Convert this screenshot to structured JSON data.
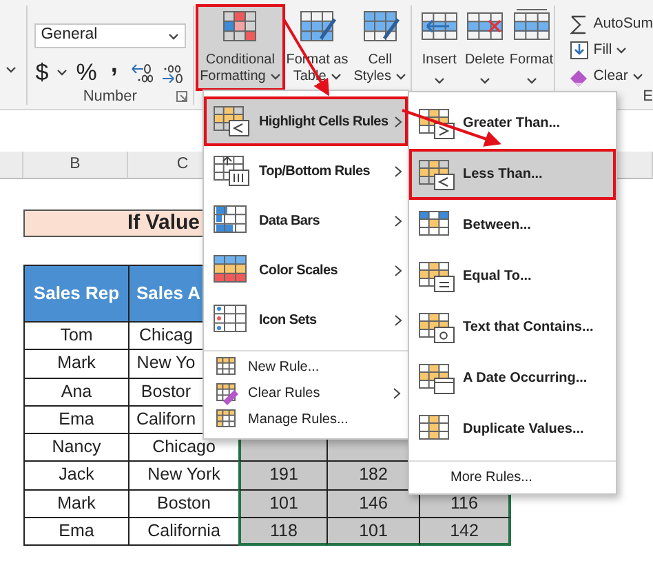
{
  "ribbon": {
    "number_group": {
      "format": "General",
      "currency": "$",
      "percent": "%",
      "comma": ",",
      "label": "Number"
    },
    "styles_group": {
      "buttons": [
        {
          "lines": [
            "Conditional",
            "Formatting"
          ],
          "selected": true
        },
        {
          "lines": [
            "Format as",
            "Table"
          ],
          "selected": false
        },
        {
          "lines": [
            "Cell",
            "Styles"
          ],
          "selected": false
        }
      ]
    },
    "cells_group": {
      "buttons": [
        "Insert",
        "Delete",
        "Format"
      ]
    },
    "editing_group": {
      "items": [
        "AutoSum",
        "Fill",
        "Clear"
      ],
      "label": "E"
    }
  },
  "sheet": {
    "column_headers": [
      "B",
      "C"
    ],
    "title": "If Value",
    "table_headers": [
      "Sales Rep",
      "Sales A"
    ],
    "rows": [
      {
        "rep": "Tom",
        "area": "Chicag",
        "values": [],
        "in_selection": false
      },
      {
        "rep": "Mark",
        "area": "New Yo",
        "values": [],
        "in_selection": false
      },
      {
        "rep": "Ana",
        "area": "Bostor",
        "values": [],
        "in_selection": false
      },
      {
        "rep": "Ema",
        "area": "Californ",
        "values": [],
        "in_selection": false
      },
      {
        "rep": "Nancy",
        "area": "Chicago",
        "values": [],
        "in_selection": true
      },
      {
        "rep": "Jack",
        "area": "New York",
        "values": [
          "191",
          "182"
        ],
        "in_selection": true
      },
      {
        "rep": "Mark",
        "area": "Boston",
        "values": [
          "101",
          "146",
          "116"
        ],
        "in_selection": true
      },
      {
        "rep": "Ema",
        "area": "California",
        "values": [
          "118",
          "101",
          "142"
        ],
        "in_selection": true
      }
    ]
  },
  "menu": {
    "items": [
      {
        "label": "Highlight Cells Rules",
        "kind": "large",
        "submenu": true,
        "selected": true
      },
      {
        "label": "Top/Bottom Rules",
        "kind": "large",
        "submenu": true,
        "selected": false
      },
      {
        "label": "Data Bars",
        "kind": "large",
        "submenu": true,
        "selected": false
      },
      {
        "label": "Color Scales",
        "kind": "large",
        "submenu": true,
        "selected": false
      },
      {
        "label": "Icon Sets",
        "kind": "large",
        "submenu": true,
        "selected": false
      },
      {
        "label": "New Rule...",
        "kind": "small",
        "submenu": false,
        "selected": false
      },
      {
        "label": "Clear Rules",
        "kind": "small",
        "submenu": true,
        "selected": false
      },
      {
        "label": "Manage Rules...",
        "kind": "small",
        "submenu": false,
        "selected": false
      }
    ]
  },
  "submenu": {
    "items": [
      {
        "label": "Greater Than...",
        "selected": false
      },
      {
        "label": "Less Than...",
        "selected": true
      },
      {
        "label": "Between...",
        "selected": false
      },
      {
        "label": "Equal To...",
        "selected": false
      },
      {
        "label": "Text that Contains...",
        "selected": false
      },
      {
        "label": "A Date Occurring...",
        "selected": false
      },
      {
        "label": "Duplicate Values...",
        "selected": false
      }
    ],
    "footer": "More Rules..."
  }
}
